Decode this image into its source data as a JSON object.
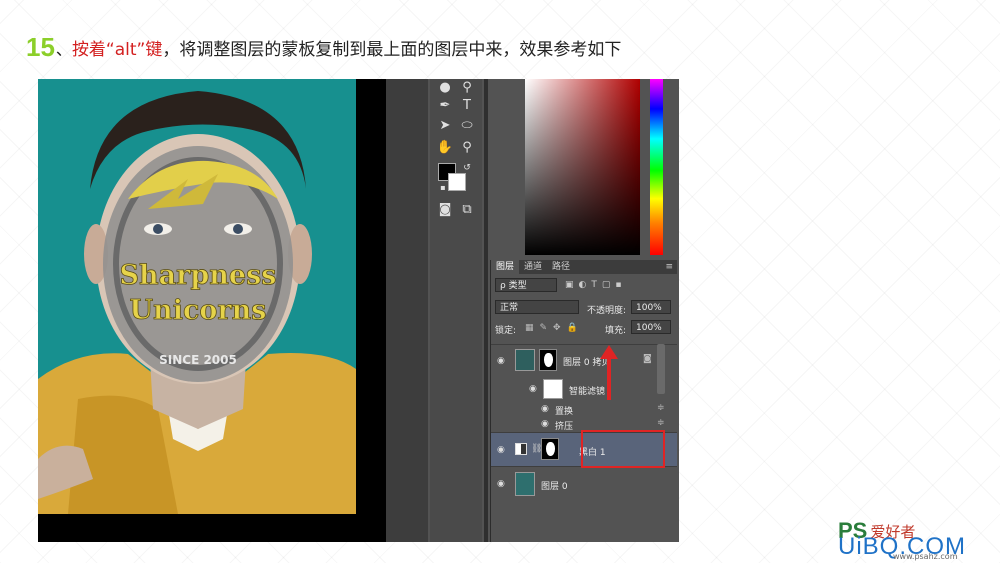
{
  "caption": {
    "step": "15",
    "separator": "、",
    "red_text": "按着“alt”键",
    "rest_text": "，将调整图层的蒙板复制到最上面的图层中来，效果参考如下"
  },
  "photo": {
    "line1": "Sharpness",
    "line2": "Unicorns",
    "line3": "SINCE 2005"
  },
  "layers_panel": {
    "tabs": [
      "图层",
      "通道",
      "路径"
    ],
    "filter_label": "ρ 类型",
    "blend_mode": "正常",
    "opacity_label": "不透明度:",
    "opacity_value": "100%",
    "lock_label": "锁定:",
    "fill_label": "填充:",
    "fill_value": "100%",
    "layers": [
      {
        "name": "图层 0 拷贝"
      },
      {
        "name": "智能滤镜"
      },
      {
        "name": "置换"
      },
      {
        "name": "挤压"
      },
      {
        "name": "黑白 1"
      },
      {
        "name": "图层 0"
      }
    ]
  },
  "logo": {
    "ps": "PS",
    "cn": "爱好者",
    "uibq": "UiBQ.COM",
    "url": "www.psahz.com"
  },
  "colors": {
    "step_green": "#8ccf2a",
    "caption_red": "#d32020",
    "highlight_red": "#e02424",
    "teal_bg": "#17908f"
  }
}
